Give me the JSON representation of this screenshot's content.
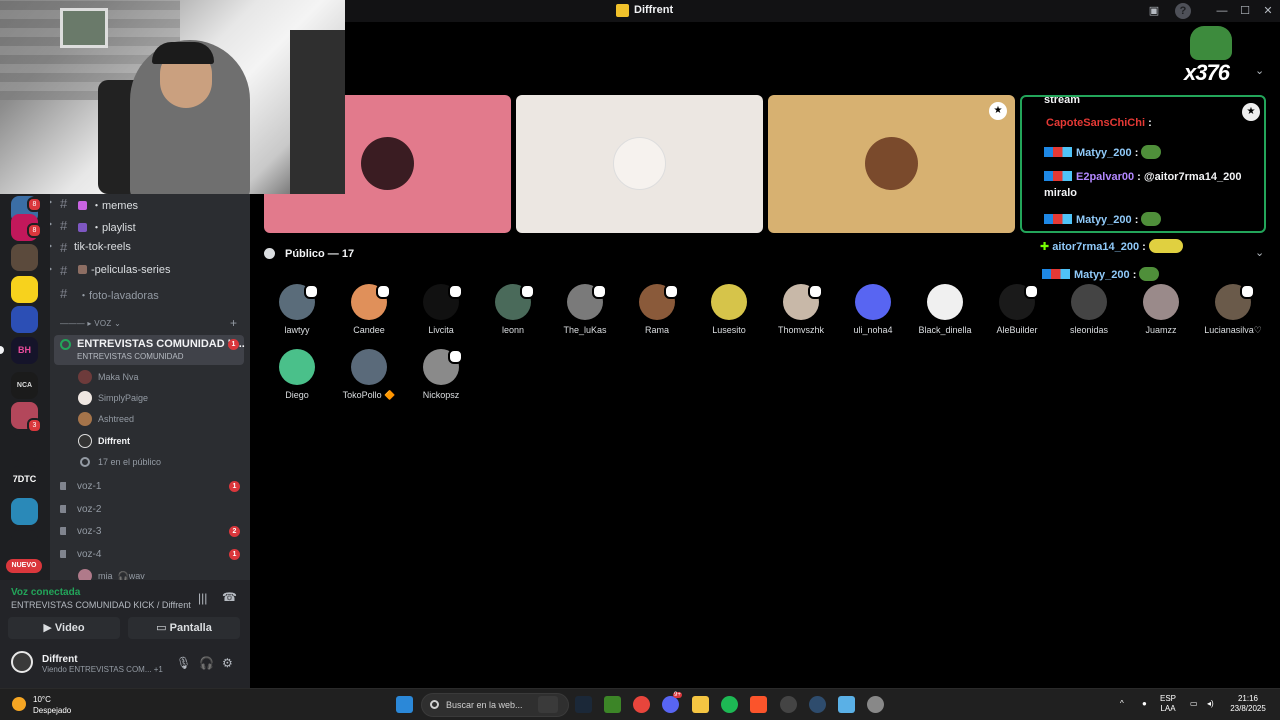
{
  "window": {
    "title": "Diffrent"
  },
  "channels": [
    {
      "label": "・memes",
      "color": "#c964e2"
    },
    {
      "label": "・playlist",
      "color": "#7e57c2"
    },
    {
      "label": "tik-tok-reels",
      "color": ""
    },
    {
      "label": "-peliculas-series",
      "color": "#8d6e63"
    },
    {
      "label": "・foto-lavadoras",
      "color": "",
      "muted": true
    }
  ],
  "category": {
    "label": "——— ▸ VOZ ⌄"
  },
  "active_channel": {
    "label": "ENTREVISTAS COMUNIDAD K...",
    "sub": "ENTREVISTAS COMUNIDAD",
    "badge": "1"
  },
  "stage_users": [
    {
      "name": "Maka Nva",
      "color": "#6d3b3b"
    },
    {
      "name": "SimplyPaige",
      "color": "#efe7e2"
    },
    {
      "name": "Ashtreed",
      "color": "#a5744a"
    },
    {
      "name": "Diffrent",
      "color": "#333333",
      "me": true
    },
    {
      "name": "17 en el público",
      "color": ""
    }
  ],
  "voice_channels": [
    {
      "label": "voz-1",
      "badge": "1"
    },
    {
      "label": "voz-2",
      "badge": ""
    },
    {
      "label": "voz-3",
      "badge": "2"
    },
    {
      "label": "voz-4",
      "badge": "1"
    }
  ],
  "voice_peek": "mia_🎧wav",
  "voice_panel": {
    "status": "Voz conectada",
    "channel": "ENTREVISTAS COMUNIDAD KICK / Diffrent",
    "video_label": "Video",
    "screen_label": "Pantalla"
  },
  "user": {
    "name": "Diffrent",
    "status": "Viendo ENTREVISTAS COM...",
    "extra": "+1"
  },
  "rail_badges": [
    "8",
    "8",
    "3"
  ],
  "rail_new": "NUEVO",
  "rail_text_server": "7DTC",
  "tiles": [
    {
      "bg": "#e27a8c",
      "avatar": "#3a1c22"
    },
    {
      "bg": "#ece7e2",
      "avatar": "#f3eeea"
    },
    {
      "bg": "#d7b171",
      "avatar": "#7a4a2c"
    }
  ],
  "chat": {
    "line0": "stream",
    "line1_user": "CapoteSansChiChi",
    "line1_sep": " :",
    "line2_user": "Matyy_200",
    "line3_user": "E2palvar00",
    "line3_text": " @aitor7rma14_200",
    "line3_cont": "miralo",
    "line4_user": "Matyy_200",
    "line5_user": "aitor7rma14_200",
    "line6_user": "Matyy_200",
    "sep": " :"
  },
  "emote_counter": "x376",
  "audience_header": "Público — 17",
  "audience": [
    {
      "name": "lawtyy",
      "color": "#5a6c7a",
      "req": true
    },
    {
      "name": "Candee",
      "color": "#e0905a",
      "req": true
    },
    {
      "name": "Livcita",
      "color": "#111111",
      "req": true
    },
    {
      "name": "leonn",
      "color": "#4a6a5a",
      "req": true
    },
    {
      "name": "The_luKas",
      "color": "#7a7a7a",
      "req": true
    },
    {
      "name": "Rama",
      "color": "#8a5a3a",
      "req": true
    },
    {
      "name": "Lusesito",
      "color": "#d6c44a",
      "req": false
    },
    {
      "name": "Thomvszhk",
      "color": "#c8b8a8",
      "req": true
    },
    {
      "name": "uli_noha4",
      "color": "#5865f2",
      "req": false
    },
    {
      "name": "Black_dinella",
      "color": "#f0f0f0",
      "req": false
    },
    {
      "name": "AleBuilder",
      "color": "#1a1a1a",
      "req": true
    },
    {
      "name": "sleonidas",
      "color": "#444444",
      "req": false
    },
    {
      "name": "Juamzz",
      "color": "#9a8a8a",
      "req": false
    },
    {
      "name": "Lucianasilva♡",
      "color": "#6a5a4a",
      "req": true
    },
    {
      "name": "Diego",
      "color": "#4ac08a",
      "req": false
    },
    {
      "name": "TokoPollo 🔶",
      "color": "#5a6a7a",
      "req": false
    },
    {
      "name": "Nickopsz",
      "color": "#8a8a8a",
      "req": true
    }
  ],
  "taskbar": {
    "temp": "10°C",
    "weather": "Despejado",
    "search": "Buscar en la web...",
    "lang": "ESP",
    "lang2": "LAA",
    "time": "21:16",
    "date": "23/8/2025",
    "chrome_badge": "9+"
  }
}
